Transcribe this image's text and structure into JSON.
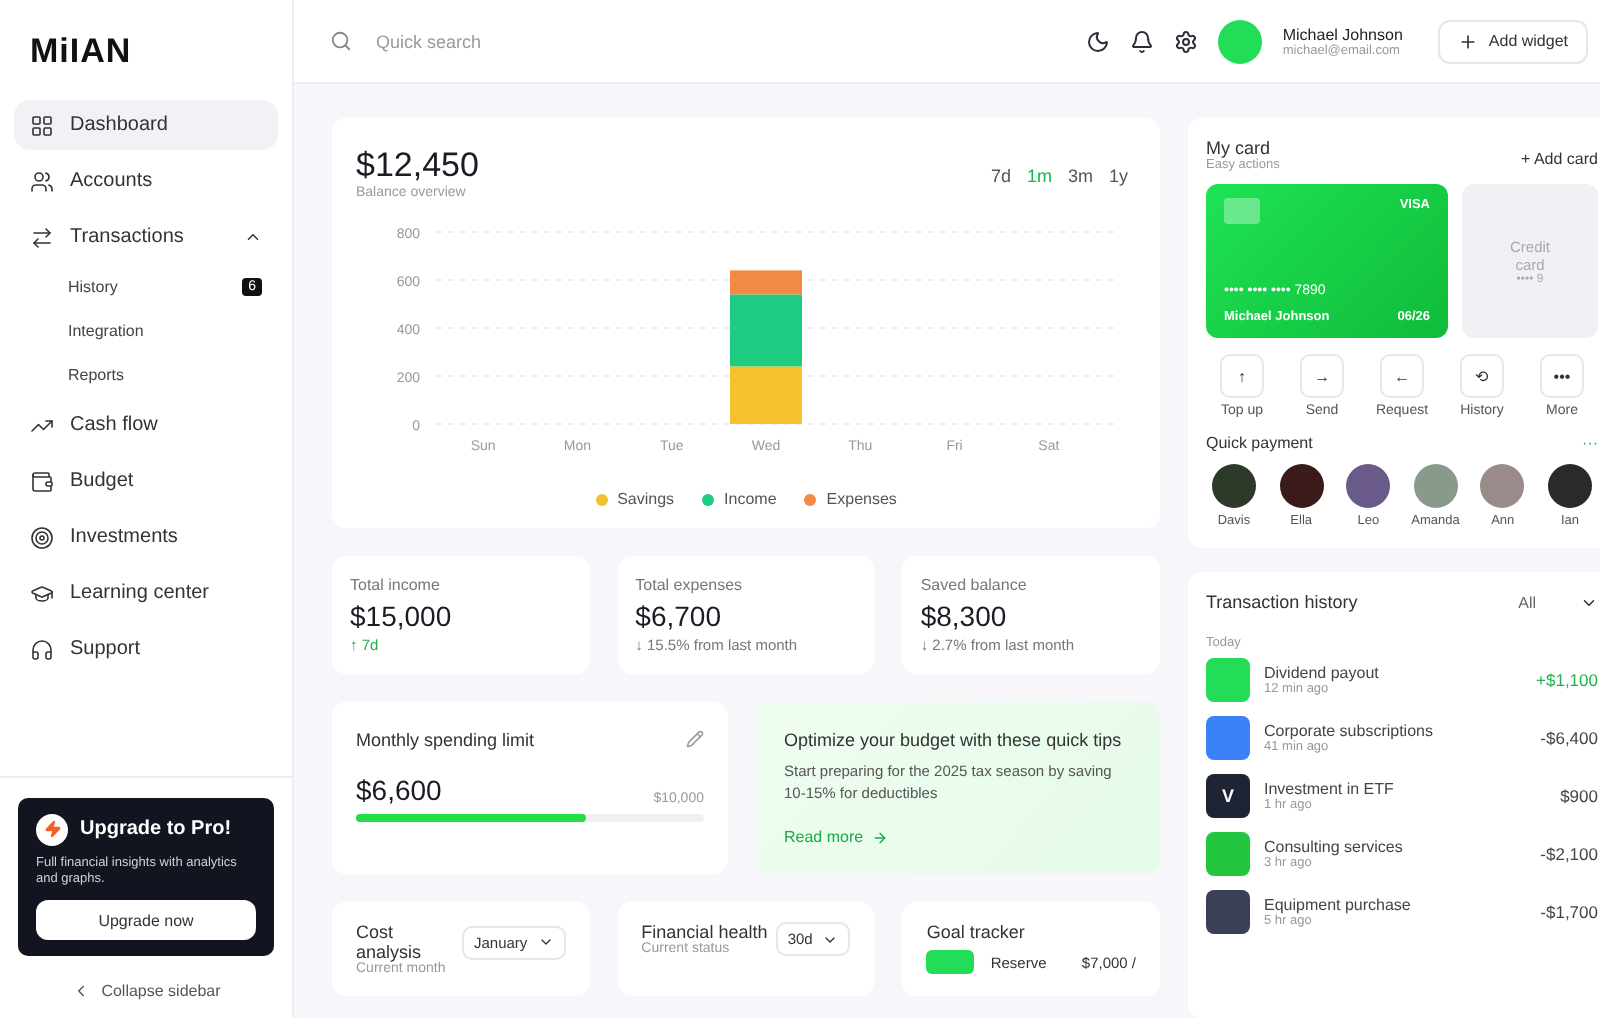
{
  "brand": "MiIAN",
  "sidebar": {
    "items": [
      {
        "label": "Dashboard",
        "selected": true
      },
      {
        "label": "Accounts",
        "selected": false
      },
      {
        "label": "Transactions",
        "selected": false,
        "expanded": true,
        "children": [
          {
            "label": "History",
            "badge": "6"
          },
          {
            "label": "Integration"
          },
          {
            "label": "Reports"
          }
        ]
      },
      {
        "label": "Cash flow",
        "selected": false
      },
      {
        "label": "Budget",
        "selected": false
      },
      {
        "label": "Investments",
        "selected": false
      },
      {
        "label": "Learning center",
        "selected": false
      },
      {
        "label": "Support",
        "selected": false
      }
    ],
    "upgrade": {
      "title": "Upgrade to Pro!",
      "text": "Full financial insights with analytics and graphs.",
      "button": "Upgrade now"
    },
    "collapse": "Collapse sidebar"
  },
  "topbar": {
    "search": {
      "placeholder": "Quick search"
    },
    "user": {
      "name": "Michael Johnson",
      "email": "michael@email.com"
    },
    "add_button": "Add widget"
  },
  "balance": {
    "amount": "$12,450",
    "subtitle": "Balance overview",
    "ranges": [
      {
        "label": "7d",
        "selected": false
      },
      {
        "label": "1m",
        "selected": true
      },
      {
        "label": "3m",
        "selected": false
      },
      {
        "label": "1y",
        "selected": false
      }
    ],
    "chart_data": {
      "type": "bar",
      "stacked": true,
      "grid": true,
      "categories": [
        "Sun",
        "Mon",
        "Tue",
        "Wed",
        "Thu",
        "Fri",
        "Sat"
      ],
      "yticks": [
        0,
        200,
        400,
        600,
        800
      ],
      "ylim": [
        0,
        800
      ],
      "series": [
        {
          "name": "Savings",
          "color": "#f5c12e",
          "values": [
            0,
            0,
            0,
            240,
            0,
            0,
            0
          ]
        },
        {
          "name": "Income",
          "color": "#1fcc82",
          "values": [
            0,
            0,
            0,
            300,
            0,
            0,
            0
          ]
        },
        {
          "name": "Expenses",
          "color": "#f08a44",
          "values": [
            0,
            0,
            0,
            100,
            0,
            0,
            0
          ]
        }
      ]
    }
  },
  "stats": [
    {
      "label": "Total income",
      "value": "$15,000",
      "trend": "↑ 7d",
      "kind": "up"
    },
    {
      "label": "Total expenses",
      "value": "$6,700",
      "trend": "↓ 15.5% from last month",
      "kind": "down"
    },
    {
      "label": "Saved balance",
      "value": "$8,300",
      "trend": "↓ 2.7% from last month",
      "kind": "down"
    }
  ],
  "spending_limit": {
    "title": "Monthly spending limit",
    "value": "$6,600",
    "max": "$10,000",
    "level": 0.66
  },
  "tips": {
    "title": "Optimize your budget with these quick tips",
    "text": "Start preparing for the 2025 tax season by saving 10-15% for deductibles",
    "link": "Read more"
  },
  "cost_analysis": {
    "title": "Cost analysis",
    "subtitle": "Current month",
    "select": "January"
  },
  "financial_health": {
    "title": "Financial health",
    "subtitle": "Current status",
    "select": "30d"
  },
  "goal_tracker": {
    "title": "Goal tracker",
    "goal": "Reserve",
    "amount": "$7,000 /"
  },
  "my_card": {
    "title": "My card",
    "subtitle": "Easy actions",
    "add": "+ Add card",
    "card": {
      "brand": "VISA",
      "number": "•••• •••• •••• 7890",
      "holder": "Michael Johnson",
      "expiry": "06/26"
    },
    "second_card": {
      "label": "Credit card",
      "number": "•••• 9"
    },
    "actions": [
      {
        "icon": "↑",
        "label": "Top up"
      },
      {
        "icon": "→",
        "label": "Send"
      },
      {
        "icon": "←",
        "label": "Request"
      },
      {
        "icon": "⟲",
        "label": "History"
      },
      {
        "icon": "•••",
        "label": "More"
      }
    ]
  },
  "quick_payment": {
    "title": "Quick payment",
    "more": "···",
    "contacts": [
      "Davis",
      "Ella",
      "Leo",
      "Amanda",
      "Ann",
      "Ian"
    ]
  },
  "transactions": {
    "title": "Transaction history",
    "filter": "All",
    "group": "Today",
    "rows": [
      {
        "name": "Dividend payout",
        "time": "12 min ago",
        "amount": "+$1,100",
        "kind": "income",
        "color": "#22dd55"
      },
      {
        "name": "Corporate subscriptions",
        "time": "41 min ago",
        "amount": "-$6,400",
        "kind": "expense",
        "color": "#3b82f6"
      },
      {
        "name": "Investment in ETF",
        "time": "1 hr ago",
        "amount": "$900",
        "kind": "neutral",
        "color": "#1e2433",
        "letter": "V"
      },
      {
        "name": "Consulting services",
        "time": "3 hr ago",
        "amount": "-$2,100",
        "kind": "expense",
        "color": "#22c53e"
      },
      {
        "name": "Equipment purchase",
        "time": "5 hr ago",
        "amount": "-$1,700",
        "kind": "expense",
        "color": "#3a4154"
      }
    ]
  }
}
